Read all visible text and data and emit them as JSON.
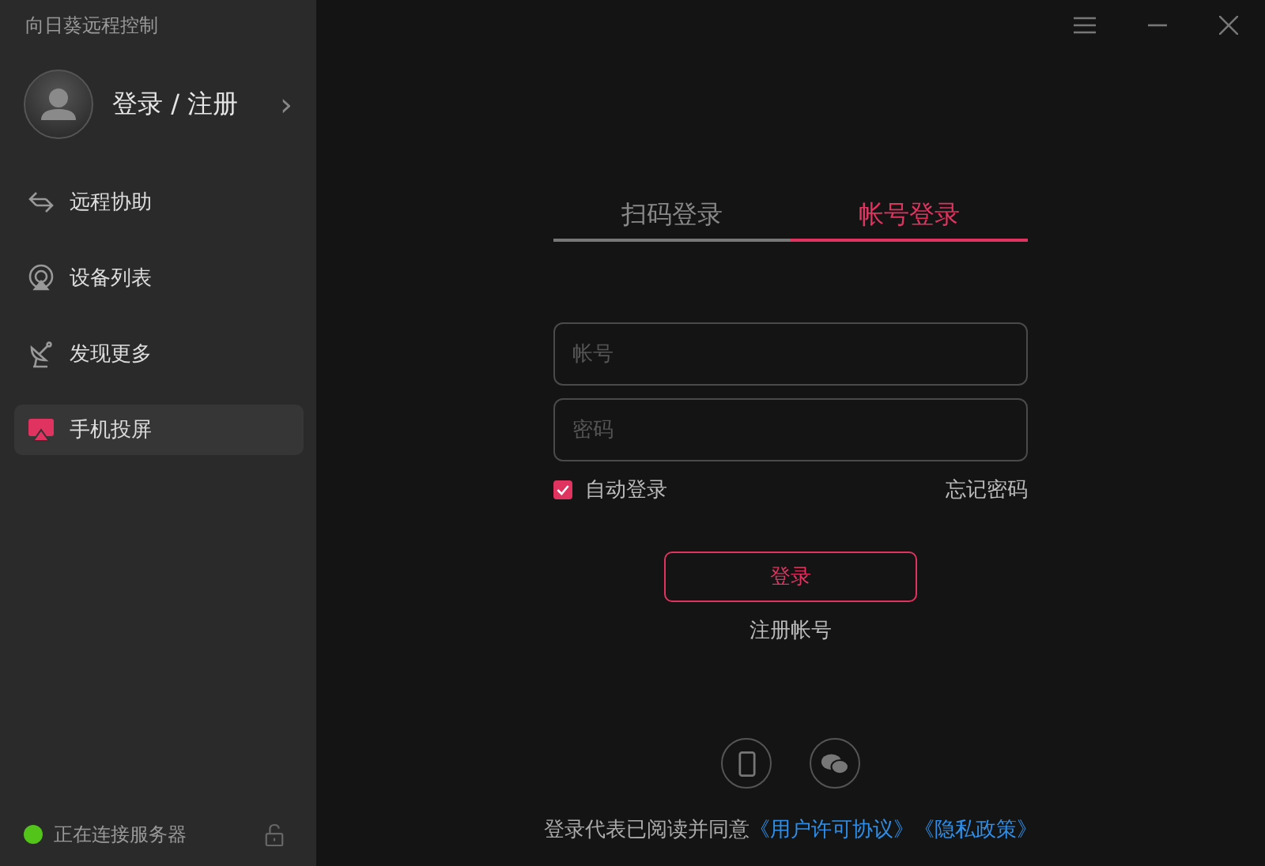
{
  "app_title": "向日葵远程控制",
  "account": {
    "label": "登录 / 注册",
    "chevron": "›"
  },
  "nav": [
    {
      "label": "远程协助",
      "kind": "remote",
      "selected": false
    },
    {
      "label": "设备列表",
      "kind": "devices",
      "selected": false
    },
    {
      "label": "发现更多",
      "kind": "discover",
      "selected": false
    },
    {
      "label": "手机投屏",
      "kind": "mirror",
      "selected": true
    }
  ],
  "status": {
    "text": "正在连接服务器",
    "color": "#52c41a"
  },
  "tabs": [
    {
      "label": "扫码登录",
      "selected": false
    },
    {
      "label": "帐号登录",
      "selected": true
    }
  ],
  "fields": [
    {
      "placeholder": "帐号"
    },
    {
      "placeholder": "密码"
    }
  ],
  "auto_login": {
    "label": "自动登录",
    "checked": true
  },
  "forgot": "忘记密码",
  "login_button": "登录",
  "register": "注册帐号",
  "agreement": {
    "text": "登录代表已阅读并同意",
    "links": [
      "《用户许可协议》",
      "《隐私政策》"
    ]
  }
}
